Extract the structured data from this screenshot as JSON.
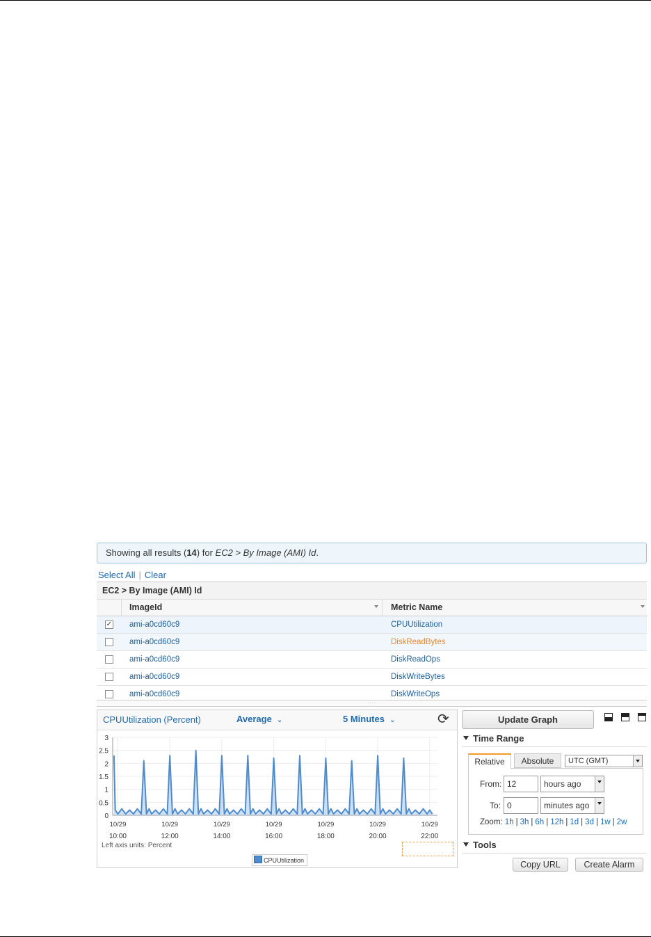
{
  "banner": {
    "prefix": "Showing all results (",
    "count": "14",
    "mid": ") for ",
    "path": "EC2 > By Image (AMI) Id",
    "suffix": "."
  },
  "links": {
    "select_all": "Select All",
    "separator": "|",
    "clear": "Clear"
  },
  "table": {
    "caption": "EC2 > By Image (AMI) Id",
    "columns": [
      "ImageId",
      "Metric Name"
    ],
    "rows": [
      {
        "image_id": "ami-a0cd60c9",
        "metric": "CPUUtilization",
        "checked": true
      },
      {
        "image_id": "ami-a0cd60c9",
        "metric": "DiskReadBytes",
        "checked": false
      },
      {
        "image_id": "ami-a0cd60c9",
        "metric": "DiskReadOps",
        "checked": false
      },
      {
        "image_id": "ami-a0cd60c9",
        "metric": "DiskWriteBytes",
        "checked": false
      },
      {
        "image_id": "ami-a0cd60c9",
        "metric": "DiskWriteOps",
        "checked": false
      }
    ],
    "check_mark": "✓",
    "grip": "....."
  },
  "graph": {
    "title": "CPUUtilization (Percent)",
    "statistic": "Average",
    "period": "5 Minutes",
    "chevron": "⌄",
    "refresh_glyph": "⟳",
    "units_label": "Left axis units: Percent",
    "legend_label": "CPUUtilization"
  },
  "chart_data": {
    "type": "line",
    "title": "CPUUtilization (Percent)",
    "xlabel": "",
    "ylabel": "Percent",
    "ylim": [
      0,
      3
    ],
    "yticks": [
      "3",
      "2.5",
      "2",
      "1.5",
      "1",
      "0.5",
      "0"
    ],
    "ytick_values": [
      3,
      2.5,
      2,
      1.5,
      1,
      0.5,
      0
    ],
    "xlim": [
      9.8,
      22.3
    ],
    "xtick_dates": [
      "10/29",
      "10/29",
      "10/29",
      "10/29",
      "10/29",
      "10/29",
      "10/29"
    ],
    "xtick_times": [
      "10:00",
      "12:00",
      "14:00",
      "16:00",
      "18:00",
      "20:00",
      "22:00"
    ],
    "xtick_values": [
      10,
      12,
      14,
      16,
      18,
      20,
      22
    ],
    "series": [
      {
        "name": "CPUUtilization",
        "color": "#4f8ccf",
        "x": [
          9.85,
          9.9,
          10.0,
          10.15,
          10.3,
          10.45,
          10.6,
          10.75,
          10.9,
          11.0,
          11.1,
          11.2,
          11.3,
          11.45,
          11.6,
          11.75,
          11.9,
          12.0,
          12.1,
          12.2,
          12.3,
          12.45,
          12.6,
          12.75,
          12.9,
          13.0,
          13.1,
          13.2,
          13.3,
          13.45,
          13.6,
          13.75,
          13.9,
          14.0,
          14.1,
          14.2,
          14.3,
          14.45,
          14.6,
          14.75,
          14.9,
          15.0,
          15.1,
          15.2,
          15.3,
          15.45,
          15.6,
          15.75,
          15.9,
          16.0,
          16.1,
          16.2,
          16.3,
          16.45,
          16.6,
          16.75,
          16.9,
          17.0,
          17.1,
          17.2,
          17.3,
          17.45,
          17.6,
          17.75,
          17.9,
          18.0,
          18.1,
          18.2,
          18.3,
          18.45,
          18.6,
          18.75,
          18.9,
          19.0,
          19.1,
          19.2,
          19.3,
          19.45,
          19.6,
          19.75,
          19.9,
          20.0,
          20.1,
          20.2,
          20.3,
          20.45,
          20.6,
          20.75,
          20.9,
          21.0,
          21.1,
          21.2,
          21.3,
          21.45,
          21.6,
          21.75,
          21.9,
          22.0,
          22.1
        ],
        "y": [
          2.3,
          0.2,
          0.05,
          0.25,
          0.05,
          0.2,
          0.05,
          0.25,
          0.05,
          2.1,
          0.05,
          0.25,
          0.05,
          0.2,
          0.05,
          0.25,
          0.05,
          2.3,
          0.05,
          0.25,
          0.05,
          0.2,
          0.05,
          0.25,
          0.05,
          2.5,
          0.05,
          0.25,
          0.05,
          0.2,
          0.05,
          0.25,
          0.05,
          2.3,
          0.05,
          0.25,
          0.05,
          0.2,
          0.05,
          0.25,
          0.05,
          2.3,
          0.05,
          0.25,
          0.05,
          0.2,
          0.05,
          0.25,
          0.05,
          2.2,
          0.05,
          0.25,
          0.05,
          0.2,
          0.05,
          0.25,
          0.05,
          2.3,
          0.05,
          0.25,
          0.05,
          0.2,
          0.05,
          0.25,
          0.05,
          2.2,
          0.05,
          0.25,
          0.05,
          0.2,
          0.05,
          0.25,
          0.05,
          2.1,
          0.05,
          0.25,
          0.05,
          0.2,
          0.05,
          0.25,
          0.05,
          2.3,
          0.05,
          0.25,
          0.05,
          0.2,
          0.05,
          0.25,
          0.05,
          2.2,
          0.05,
          0.25,
          0.05,
          0.2,
          0.05,
          0.25,
          0.05,
          0.2,
          0.05
        ]
      }
    ],
    "grid": true,
    "legend": "bottom-center"
  },
  "controls": {
    "update_graph": "Update Graph",
    "time_range_title": "Time Range",
    "tab_relative": "Relative",
    "tab_absolute": "Absolute",
    "timezone": "UTC (GMT)",
    "from_label": "From:",
    "from_value": "12",
    "from_unit": "hours ago",
    "to_label": "To:",
    "to_value": "0",
    "to_unit": "minutes ago",
    "zoom_label": "Zoom:",
    "zoom_options": [
      "1h",
      "3h",
      "6h",
      "12h",
      "1d",
      "3d",
      "1w",
      "2w"
    ],
    "zoom_separator": "|",
    "tools_title": "Tools",
    "copy_url": "Copy URL",
    "create_alarm": "Create Alarm"
  }
}
